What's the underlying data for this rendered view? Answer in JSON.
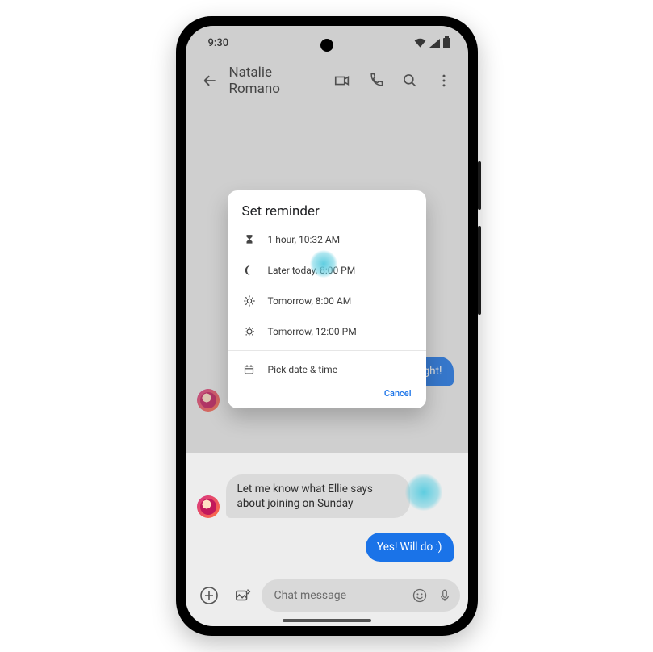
{
  "status": {
    "time": "9:30"
  },
  "appbar": {
    "contact_name": "Natalie Romano"
  },
  "chat": {
    "sent_top": "night!",
    "received_1": "",
    "received_2": "Let me know what Ellie says about joining on Sunday",
    "sent_bottom": "Yes! Will do :)"
  },
  "compose": {
    "placeholder": "Chat message"
  },
  "dialog": {
    "title": "Set reminder",
    "options": [
      {
        "label": "1 hour, 10:32 AM"
      },
      {
        "label": "Later today, 8:00 PM"
      },
      {
        "label": "Tomorrow, 8:00 AM"
      },
      {
        "label": "Tomorrow, 12:00 PM"
      }
    ],
    "pick": "Pick date & time",
    "cancel": "Cancel"
  }
}
